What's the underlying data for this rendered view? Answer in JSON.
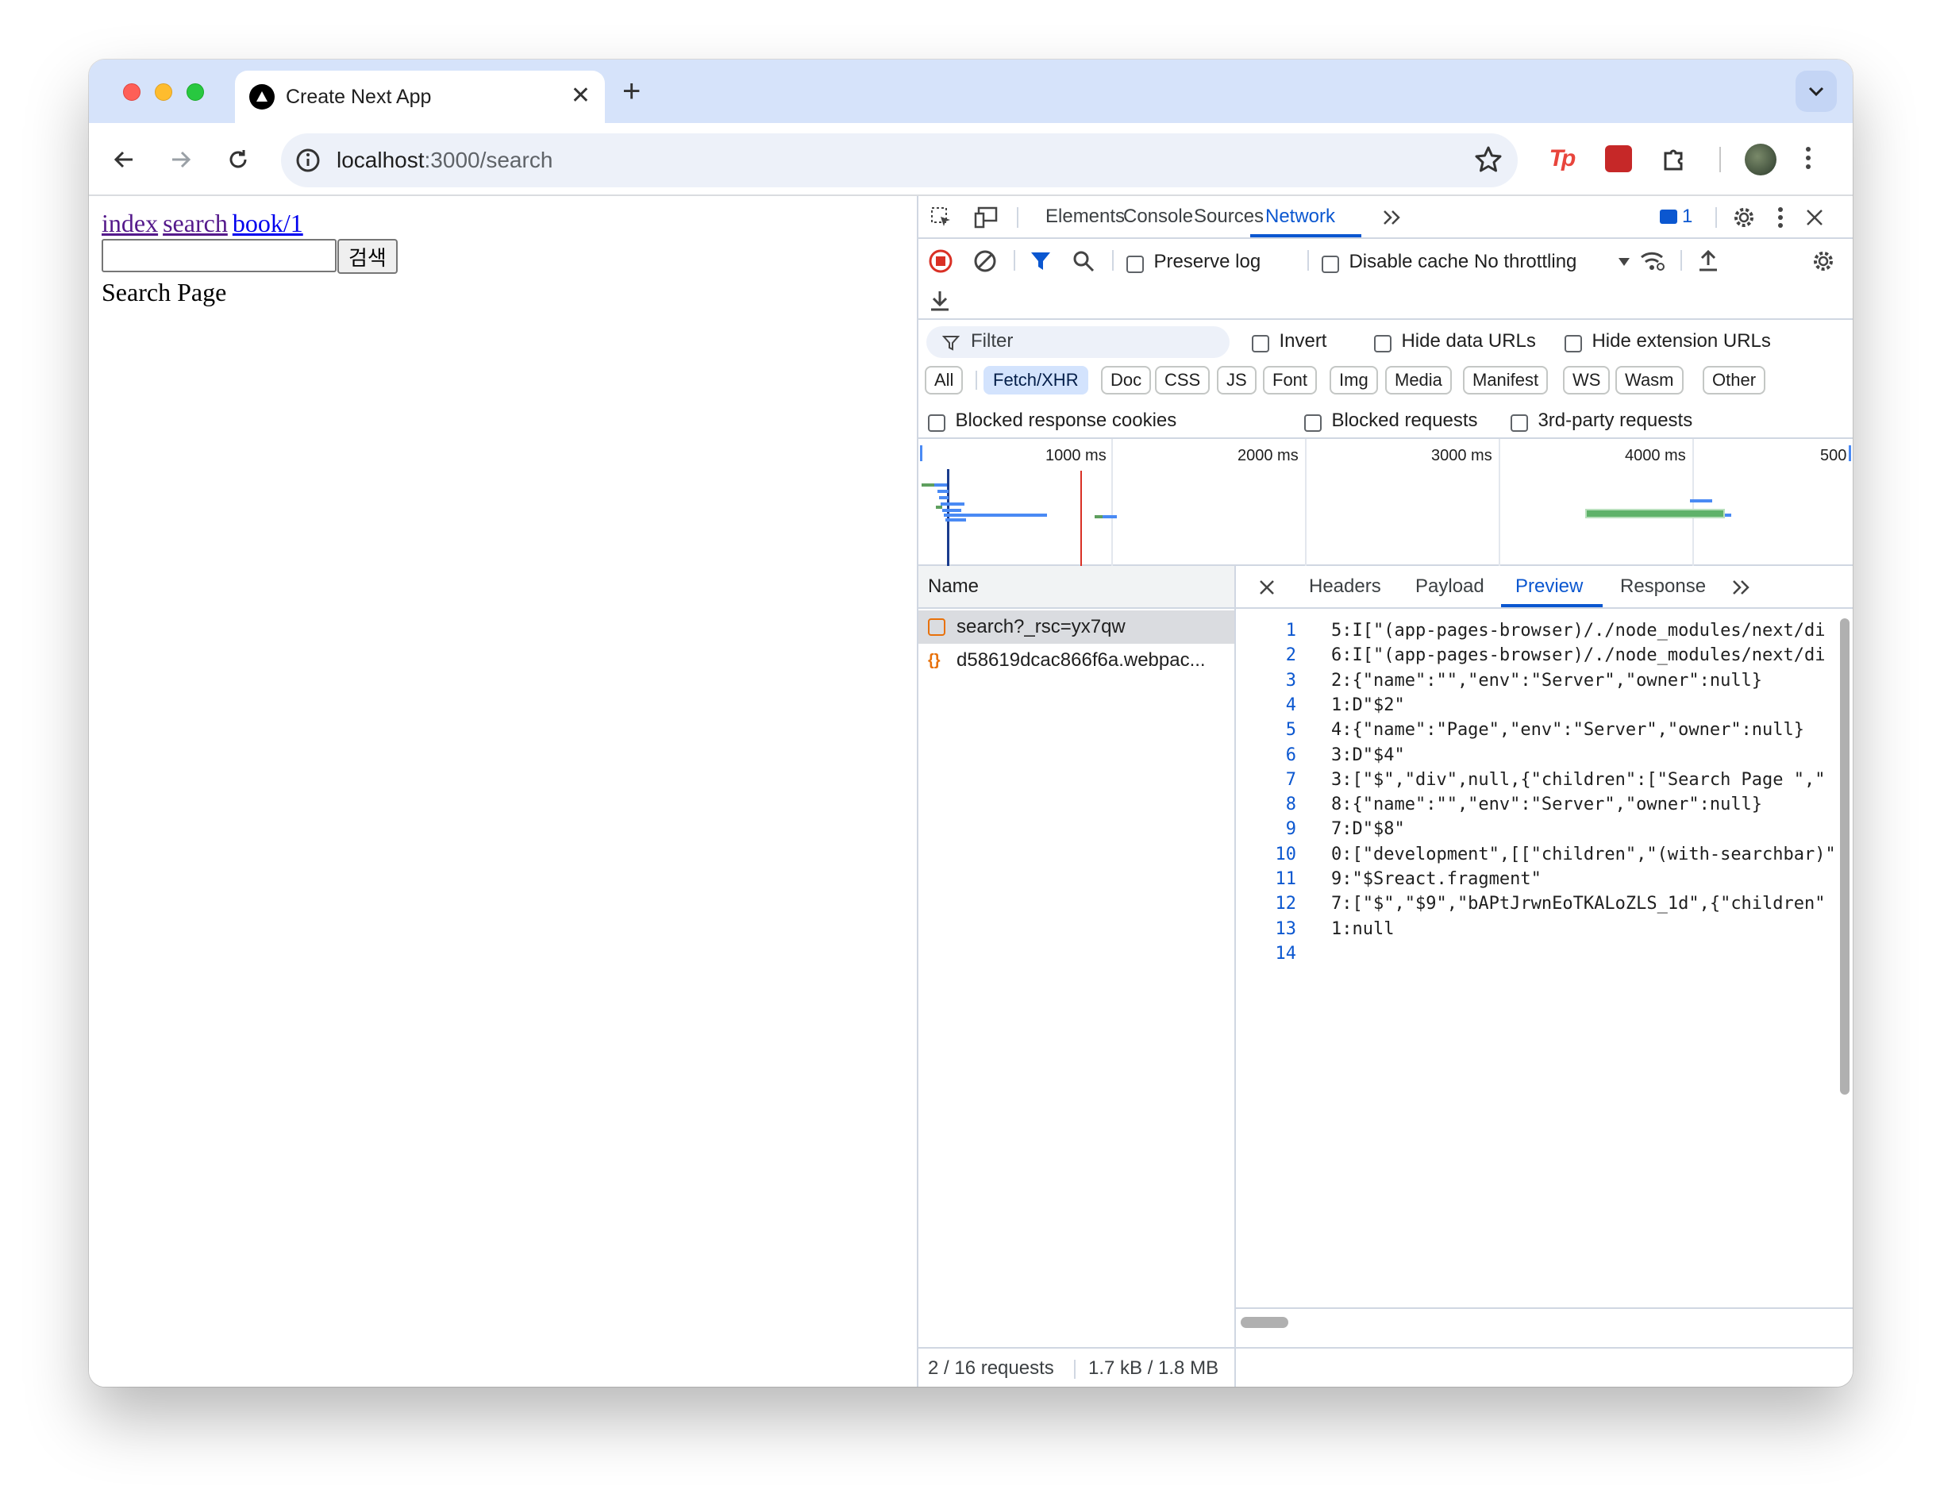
{
  "browser": {
    "tab_title": "Create Next App",
    "url_host": "localhost",
    "url_rest": ":3000/search"
  },
  "page": {
    "links": [
      "index",
      "search",
      "book/1"
    ],
    "search_button": "검색",
    "search_input_value": "",
    "heading": "Search Page"
  },
  "devtools": {
    "tabs": [
      "Elements",
      "Console",
      "Sources",
      "Network"
    ],
    "active_tab": "Network",
    "message_count": "1",
    "toolbar": {
      "preserve_log": "Preserve log",
      "disable_cache": "Disable cache",
      "throttling": "No throttling"
    },
    "filter": {
      "placeholder": "Filter",
      "invert": "Invert",
      "hide_data_urls": "Hide data URLs",
      "hide_extension_urls": "Hide extension URLs"
    },
    "types": [
      "All",
      "Fetch/XHR",
      "Doc",
      "CSS",
      "JS",
      "Font",
      "Img",
      "Media",
      "Manifest",
      "WS",
      "Wasm",
      "Other"
    ],
    "active_type": "Fetch/XHR",
    "blocked": {
      "cookies": "Blocked response cookies",
      "requests": "Blocked requests",
      "third_party": "3rd-party requests"
    },
    "overview_labels": [
      "1000 ms",
      "2000 ms",
      "3000 ms",
      "4000 ms",
      "500"
    ],
    "requests_header": "Name",
    "requests": [
      "search?_rsc=yx7qw",
      "d58619dcac866f6a.webpac..."
    ],
    "detail_tabs": [
      "Headers",
      "Payload",
      "Preview",
      "Response"
    ],
    "active_detail_tab": "Preview",
    "preview_lines": [
      {
        "n": "1",
        "text": "5:I[\"(app-pages-browser)/./node_modules/next/di"
      },
      {
        "n": "2",
        "text": "6:I[\"(app-pages-browser)/./node_modules/next/di"
      },
      {
        "n": "3",
        "text": "2:{\"name\":\"\",\"env\":\"Server\",\"owner\":null}"
      },
      {
        "n": "4",
        "text": "1:D\"$2\""
      },
      {
        "n": "5",
        "text": "4:{\"name\":\"Page\",\"env\":\"Server\",\"owner\":null}"
      },
      {
        "n": "6",
        "text": "3:D\"$4\""
      },
      {
        "n": "7",
        "text": "3:[\"$\",\"div\",null,{\"children\":[\"Search Page \",\""
      },
      {
        "n": "8",
        "text": "8:{\"name\":\"\",\"env\":\"Server\",\"owner\":null}"
      },
      {
        "n": "9",
        "text": "7:D\"$8\""
      },
      {
        "n": "10",
        "text": "0:[\"development\",[[\"children\",\"(with-searchbar)\""
      },
      {
        "n": "11",
        "text": "9:\"$Sreact.fragment\""
      },
      {
        "n": "12",
        "text": "7:[\"$\",\"$9\",\"bAPtJrwnEoTKALoZLS_1d\",{\"children\""
      },
      {
        "n": "13",
        "text": "1:null"
      },
      {
        "n": "14",
        "text": ""
      }
    ],
    "status": {
      "requests": "2 / 16 requests",
      "size": "1.7 kB / 1.8 MB"
    }
  }
}
